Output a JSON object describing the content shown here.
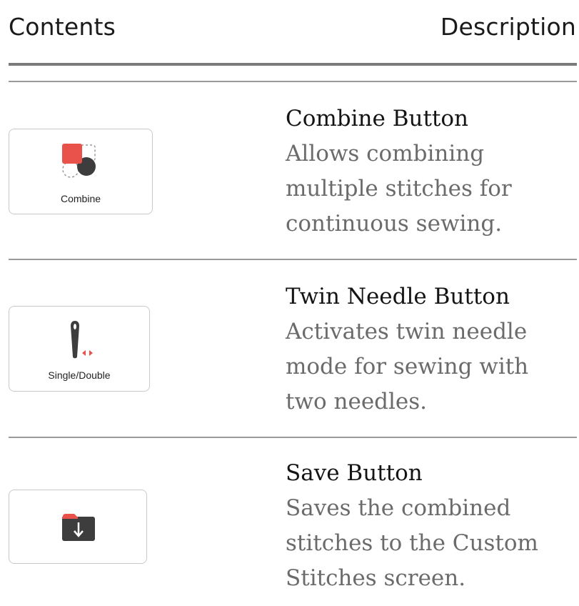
{
  "header": {
    "contents_label": "Contents",
    "description_label": "Description"
  },
  "rows": [
    {
      "button_label": "Combine",
      "icon": "combine-icon",
      "title": "Combine Button",
      "description_lines": [
        "Allows combining",
        "multiple stitches for",
        "continuous sewing."
      ]
    },
    {
      "button_label": "Single/Double",
      "icon": "twin-needle-icon",
      "title": "Twin Needle Button",
      "description_lines": [
        "Activates twin needle",
        "mode for sewing with",
        "two needles."
      ]
    },
    {
      "button_label": "",
      "icon": "save-folder-icon",
      "title": "Save Button",
      "description_lines": [
        "Saves the combined",
        "stitches to the Custom",
        "Stitches screen."
      ]
    }
  ],
  "colors": {
    "accent_red": "#e8524a",
    "icon_dark": "#3d3d3d",
    "rule": "#8e8e8e",
    "title_text": "#141414",
    "body_text": "#6b6b6b"
  }
}
